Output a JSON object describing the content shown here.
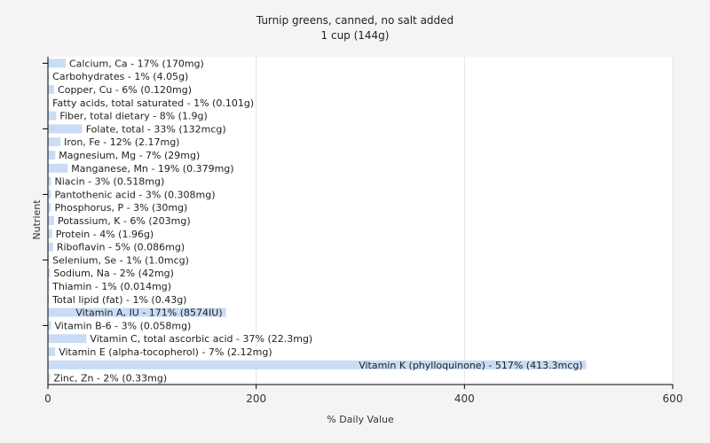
{
  "chart_data": {
    "type": "bar",
    "orientation": "horizontal",
    "title": "Turnip greens, canned, no salt added",
    "subtitle": "1 cup (144g)",
    "xlabel": "% Daily Value",
    "ylabel": "Nutrient",
    "xlim": [
      0,
      600
    ],
    "xticks": [
      0,
      200,
      400,
      600
    ],
    "grid": true,
    "bar_color": "#c8dcf5",
    "categories": [
      "Calcium, Ca - 17% (170mg)",
      "Carbohydrates - 1% (4.05g)",
      "Copper, Cu - 6% (0.120mg)",
      "Fatty acids, total saturated - 1% (0.101g)",
      "Fiber, total dietary - 8% (1.9g)",
      "Folate, total - 33% (132mcg)",
      "Iron, Fe - 12% (2.17mg)",
      "Magnesium, Mg - 7% (29mg)",
      "Manganese, Mn - 19% (0.379mg)",
      "Niacin - 3% (0.518mg)",
      "Pantothenic acid - 3% (0.308mg)",
      "Phosphorus, P - 3% (30mg)",
      "Potassium, K - 6% (203mg)",
      "Protein - 4% (1.96g)",
      "Riboflavin - 5% (0.086mg)",
      "Selenium, Se - 1% (1.0mcg)",
      "Sodium, Na - 2% (42mg)",
      "Thiamin - 1% (0.014mg)",
      "Total lipid (fat) - 1% (0.43g)",
      "Vitamin A, IU - 171% (8574IU)",
      "Vitamin B-6 - 3% (0.058mg)",
      "Vitamin C, total ascorbic acid - 37% (22.3mg)",
      "Vitamin E (alpha-tocopherol) - 7% (2.12mg)",
      "Vitamin K (phylloquinone) - 517% (413.3mcg)",
      "Zinc, Zn - 2% (0.33mg)"
    ],
    "values": [
      17,
      1,
      6,
      1,
      8,
      33,
      12,
      7,
      19,
      3,
      3,
      3,
      6,
      4,
      5,
      1,
      2,
      1,
      1,
      171,
      3,
      37,
      7,
      517,
      2
    ]
  }
}
